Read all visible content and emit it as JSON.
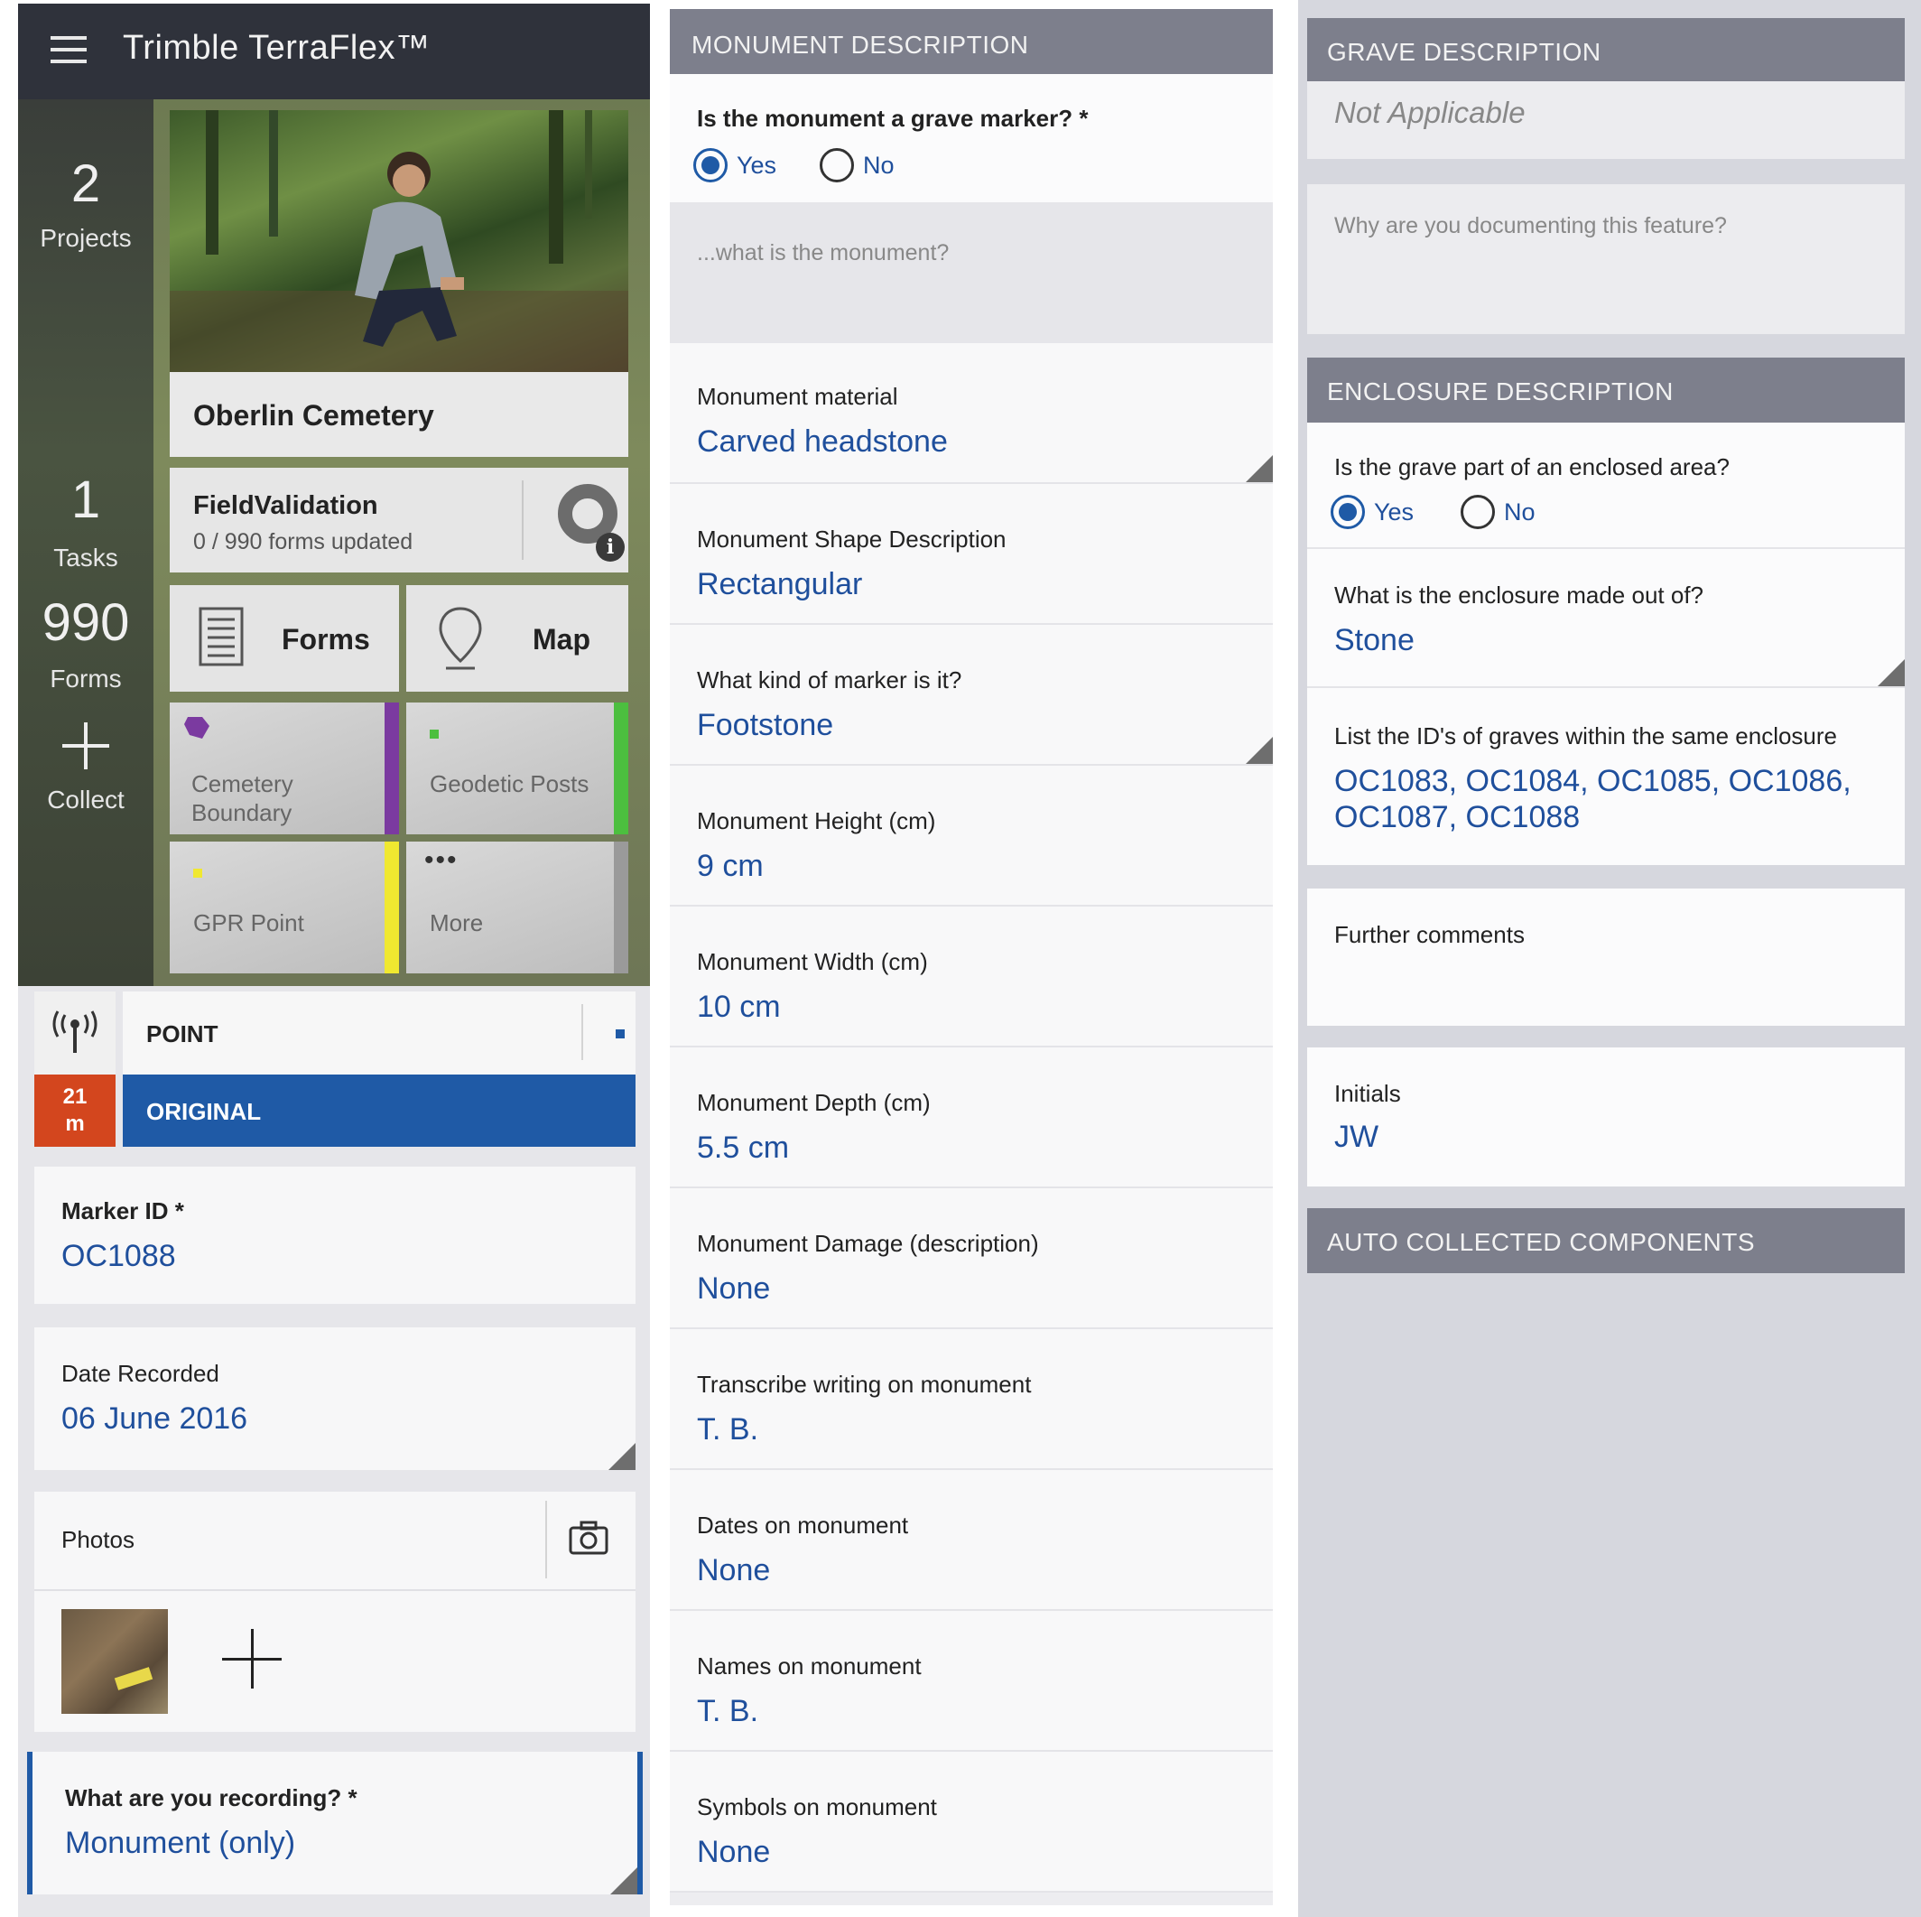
{
  "app": {
    "title": "Trimble TerraFlex™",
    "stats": [
      {
        "value": "2",
        "label": "Projects"
      },
      {
        "value": "1",
        "label": "Tasks"
      },
      {
        "value": "990",
        "label": "Forms"
      }
    ],
    "collect_label": "Collect",
    "project_name": "Oberlin Cemetery",
    "task": {
      "title": "FieldValidation",
      "subtitle": "0 / 990 forms updated"
    },
    "buttons": {
      "forms": "Forms",
      "map": "Map"
    },
    "form_tiles": [
      {
        "label": "Cemetery Boundary",
        "color": "#7b3aa0"
      },
      {
        "label": "Geodetic Posts",
        "color": "#4cbf3f"
      },
      {
        "label": "GPR Point",
        "color": "#f0e830"
      },
      {
        "label": "More",
        "color": "#9a9a9a"
      }
    ]
  },
  "gps": {
    "accuracy_value": "21",
    "accuracy_unit": "m",
    "point_label": "POINT",
    "original_label": "ORIGINAL"
  },
  "left_form": {
    "marker_id": {
      "label": "Marker ID *",
      "value": "OC1088"
    },
    "date_recorded": {
      "label": "Date Recorded",
      "value": "06 June 2016"
    },
    "photos_label": "Photos",
    "recording": {
      "label": "What are you recording? *",
      "value": "Monument (only)"
    }
  },
  "monument": {
    "header": "MONUMENT DESCRIPTION",
    "grave_marker": {
      "question": "Is the monument a grave marker? *",
      "yes": "Yes",
      "no": "No",
      "selected": "yes"
    },
    "what_placeholder": "...what is the monument?",
    "fields": [
      {
        "label": "Monument material",
        "value": "Carved headstone"
      },
      {
        "label": "Monument Shape Description",
        "value": "Rectangular"
      },
      {
        "label": "What kind of marker is it?",
        "value": "Footstone"
      },
      {
        "label": "Monument Height (cm)",
        "value": "9 cm"
      },
      {
        "label": "Monument Width (cm)",
        "value": "10 cm"
      },
      {
        "label": "Monument Depth (cm)",
        "value": "5.5 cm"
      },
      {
        "label": "Monument Damage (description)",
        "value": "None"
      },
      {
        "label": "Transcribe writing on monument",
        "value": "T. B."
      },
      {
        "label": "Dates on monument",
        "value": "None"
      },
      {
        "label": "Names on monument",
        "value": "T. B."
      },
      {
        "label": "Symbols on monument",
        "value": "None"
      }
    ]
  },
  "grave": {
    "header": "GRAVE DESCRIPTION",
    "value": "Not Applicable",
    "why_placeholder": "Why are you documenting this feature?"
  },
  "enclosure": {
    "header": "ENCLOSURE DESCRIPTION",
    "enclosed": {
      "question": "Is the grave part of an enclosed area?",
      "yes": "Yes",
      "no": "No",
      "selected": "yes"
    },
    "material": {
      "label": "What is the enclosure made out of?",
      "value": "Stone"
    },
    "ids": {
      "label": "List the ID's of graves within the same enclosure",
      "line1": "OC1083, OC1084, OC1085, OC1086,",
      "line2": "OC1087, OC1088"
    },
    "comments_label": "Further comments",
    "initials": {
      "label": "Initials",
      "value": "JW"
    }
  },
  "auto_header": "AUTO COLLECTED COMPONENTS"
}
